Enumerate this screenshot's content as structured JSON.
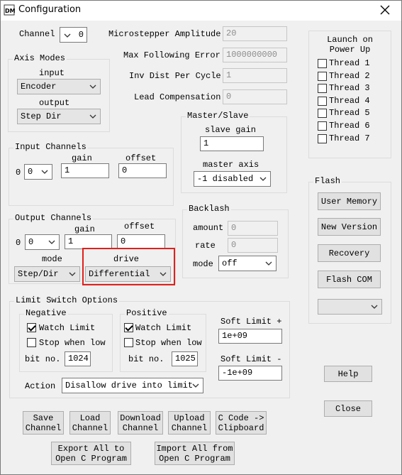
{
  "window": {
    "title": "Configuration",
    "icon_text": "DM",
    "close_label": "✕"
  },
  "channel": {
    "label": "Channel",
    "value": "0"
  },
  "params": {
    "microstepper_label": "Microstepper Amplitude",
    "microstepper_value": "20",
    "max_following_label": "Max Following Error",
    "max_following_value": "1000000000",
    "inv_dist_label": "Inv Dist Per Cycle",
    "inv_dist_value": "1",
    "lead_comp_label": "Lead Compensation",
    "lead_comp_value": "0"
  },
  "axis_modes": {
    "title": "Axis Modes",
    "input_label": "input",
    "input_value": "Encoder",
    "output_label": "output",
    "output_value": "Step Dir"
  },
  "master_slave": {
    "title": "Master/Slave",
    "slave_gain_label": "slave gain",
    "slave_gain_value": "1",
    "master_axis_label": "master axis",
    "master_axis_value": "-1 disabled"
  },
  "input_channels": {
    "title": "Input Channels",
    "gain_label": "gain",
    "offset_label": "offset",
    "index_label": "0",
    "select_value": "0",
    "gain_value": "1",
    "offset_value": "0"
  },
  "output_channels": {
    "title": "Output Channels",
    "gain_label": "gain",
    "offset_label": "offset",
    "index_label": "0",
    "select_value": "0",
    "gain_value": "1",
    "offset_value": "0",
    "mode_label": "mode",
    "mode_value": "Step/Dir",
    "drive_label": "drive",
    "drive_value": "Differential"
  },
  "backlash": {
    "title": "Backlash",
    "amount_label": "amount",
    "amount_value": "0",
    "rate_label": "rate",
    "rate_value": "0",
    "mode_label": "mode",
    "mode_value": "off"
  },
  "launch": {
    "title": "Launch on\nPower Up",
    "threads": [
      "Thread 1",
      "Thread 2",
      "Thread 3",
      "Thread 4",
      "Thread 5",
      "Thread 6",
      "Thread 7"
    ]
  },
  "flash": {
    "title": "Flash",
    "user_memory": "User Memory",
    "new_version": "New Version",
    "recovery": "Recovery",
    "flash_com": "Flash COM",
    "select_value": ""
  },
  "limits": {
    "title": "Limit Switch Options",
    "negative": {
      "title": "Negative",
      "watch": "Watch Limit",
      "stop_low": "Stop when low",
      "bit_label": "bit no.",
      "bit_value": "1024"
    },
    "positive": {
      "title": "Positive",
      "watch": "Watch Limit",
      "stop_low": "Stop when low",
      "bit_label": "bit no.",
      "bit_value": "1025"
    },
    "soft_plus_label": "Soft Limit +",
    "soft_plus_value": "1e+09",
    "soft_minus_label": "Soft Limit -",
    "soft_minus_value": "-1e+09",
    "action_label": "Action",
    "action_value": "Disallow drive into limit"
  },
  "buttons": {
    "help": "Help",
    "close": "Close",
    "save_channel": "Save\nChannel",
    "load_channel": "Load\nChannel",
    "download_channel": "Download\nChannel",
    "upload_channel": "Upload\nChannel",
    "c_code": "C Code ->\nClipboard",
    "export_all": "Export All to\nOpen C Program",
    "import_all": "Import All from\nOpen C Program"
  },
  "colors": {
    "highlight": "#e0201c"
  }
}
